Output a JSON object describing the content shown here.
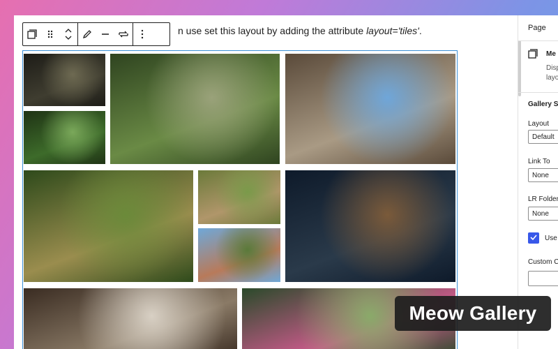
{
  "paragraph": {
    "prefix": "n use set this layout by adding the attribute ",
    "code": "layout='tiles'",
    "suffix": "."
  },
  "toolbar": {
    "buttons": [
      "block-type",
      "drag",
      "move-up-down",
      "edit",
      "align",
      "replace",
      "more-options"
    ]
  },
  "gallery": {
    "layout": "tiles",
    "tiles": [
      {
        "name": "tile-tunnel-dark",
        "colors": [
          "#1d1c17",
          "#3f3d30",
          "#6e6a52"
        ]
      },
      {
        "name": "tile-forest-stairs",
        "colors": [
          "#1f3315",
          "#3d6b2a",
          "#7aa85a"
        ]
      },
      {
        "name": "tile-overgrown-tunnel",
        "colors": [
          "#2f4420",
          "#6a8a45",
          "#9aa27a"
        ]
      },
      {
        "name": "tile-japanese-street",
        "colors": [
          "#5a4a3a",
          "#a99a84",
          "#6fa6d9"
        ]
      },
      {
        "name": "tile-ufo-house",
        "colors": [
          "#2e4a1b",
          "#9a8d4e",
          "#6b8a3a"
        ]
      },
      {
        "name": "tile-abandoned-house",
        "colors": [
          "#6b7a3a",
          "#b0966a",
          "#7a9a4a"
        ]
      },
      {
        "name": "tile-carousel",
        "colors": [
          "#6fa8d8",
          "#b87a5a",
          "#5a7a3a"
        ]
      },
      {
        "name": "tile-dragon-roof",
        "colors": [
          "#0e1a2a",
          "#2a3a4a",
          "#7a5a3a"
        ]
      },
      {
        "name": "tile-ruined-room",
        "colors": [
          "#3a2c22",
          "#8a7a66",
          "#d8d0c4"
        ]
      },
      {
        "name": "tile-flower-garden",
        "colors": [
          "#2a4a2a",
          "#c85a8a",
          "#8aaa6a"
        ]
      }
    ]
  },
  "sidebar": {
    "tab_label": "Page",
    "block_title": "Me",
    "block_desc_1": "Disp",
    "block_desc_2": "layo",
    "section_title": "Gallery Se",
    "layout_label": "Layout",
    "layout_value": "Default",
    "link_label": "Link To",
    "link_value": "None",
    "lr_label": "LR Folder",
    "lr_value": "None",
    "use_label": "Use",
    "custom_label": "Custom C"
  },
  "badge": {
    "text": "Meow Gallery"
  },
  "colors": {
    "accent": "#3858e9",
    "selection": "#3a8fd6"
  }
}
